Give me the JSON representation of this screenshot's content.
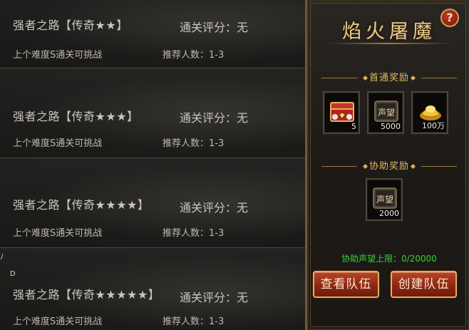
{
  "list": {
    "rows": [
      {
        "name": "强者之路【传奇★★】",
        "score": "通关评分：无",
        "requirement": "上个难度S通关可挑战",
        "recommend": "推荐人数：1-3"
      },
      {
        "name": "强者之路【传奇★★★】",
        "score": "通关评分：无",
        "requirement": "上个难度S通关可挑战",
        "recommend": "推荐人数：1-3"
      },
      {
        "name": "强者之路【传奇★★★★】",
        "score": "通关评分：无",
        "requirement": "上个难度S通关可挑战",
        "recommend": "推荐人数：1-3"
      },
      {
        "name": "强者之路【传奇★★★★★】",
        "score": "通关评分：无",
        "requirement": "上个难度S通关可挑战",
        "recommend": "推荐人数：1-3"
      }
    ],
    "edge_marks": [
      "/",
      "D"
    ]
  },
  "panel": {
    "help_label": "?",
    "title": "焰火屠魔",
    "first_clear_heading": "首通奖励",
    "first_clear_rewards": [
      {
        "icon": "treasure-chest-icon",
        "count": "5"
      },
      {
        "icon": "reputation-scroll-icon",
        "label": "声望",
        "count": "5000"
      },
      {
        "icon": "gold-ingot-icon",
        "count": "100万"
      }
    ],
    "assist_heading": "协助奖励",
    "assist_rewards": [
      {
        "icon": "reputation-scroll-icon",
        "label": "声望",
        "count": "2000"
      }
    ],
    "assist_limit": "协助声望上限：0/20000",
    "view_team_label": "查看队伍",
    "create_team_label": "创建队伍"
  },
  "colors": {
    "accent_gold": "#e8c98a",
    "button_red": "#8e2714",
    "limit_green": "#34d33a"
  }
}
